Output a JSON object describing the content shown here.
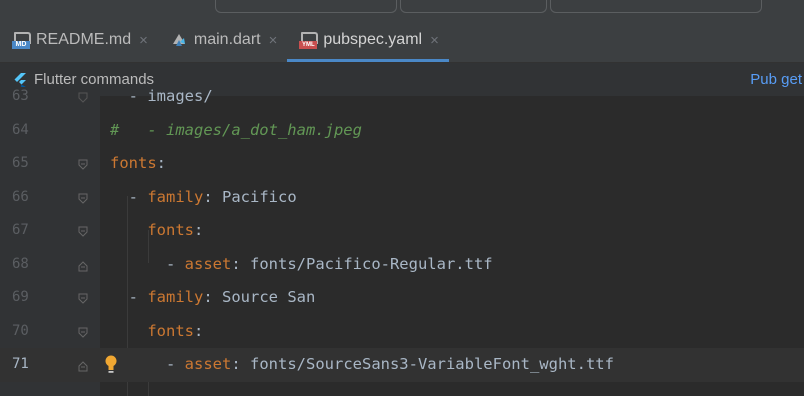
{
  "tabs": [
    {
      "label": "README.md",
      "icon": "markdown-file-icon",
      "active": false
    },
    {
      "label": "main.dart",
      "icon": "dart-file-icon",
      "active": false
    },
    {
      "label": "pubspec.yaml",
      "icon": "yaml-file-icon",
      "active": true
    }
  ],
  "icons": {
    "md_badge": "MD",
    "yml_badge": "YML"
  },
  "command_bar": {
    "title": "Flutter commands",
    "pub_get": "Pub get"
  },
  "editor": {
    "current_line": 71,
    "lines": [
      {
        "n": "63",
        "dash": "  - ",
        "key": "",
        "colon": "",
        "value": "images/",
        "comment": ""
      },
      {
        "n": "64",
        "dash": "",
        "key": "",
        "colon": "",
        "value": "",
        "comment": "#   - images/a_dot_ham.jpeg"
      },
      {
        "n": "65",
        "dash": "",
        "key": "fonts",
        "colon": ":",
        "value": "",
        "comment": ""
      },
      {
        "n": "66",
        "dash": "  - ",
        "key": "family",
        "colon": ":",
        "value": " Pacifico",
        "comment": ""
      },
      {
        "n": "67",
        "dash": "    ",
        "key": "fonts",
        "colon": ":",
        "value": "",
        "comment": ""
      },
      {
        "n": "68",
        "dash": "      - ",
        "key": "asset",
        "colon": ":",
        "value": " fonts/Pacifico-Regular.ttf",
        "comment": ""
      },
      {
        "n": "69",
        "dash": "  - ",
        "key": "family",
        "colon": ":",
        "value": " Source San",
        "comment": ""
      },
      {
        "n": "70",
        "dash": "    ",
        "key": "fonts",
        "colon": ":",
        "value": "",
        "comment": ""
      },
      {
        "n": "71",
        "dash": "      - ",
        "key": "asset",
        "colon": ":",
        "value": " fonts/SourceSans3-VariableFont_wght.ttf",
        "comment": ""
      }
    ]
  },
  "colors": {
    "key": "#cc7832",
    "comment": "#629755",
    "text": "#a9b7c6",
    "accent": "#4a88c7",
    "link": "#589df6"
  }
}
